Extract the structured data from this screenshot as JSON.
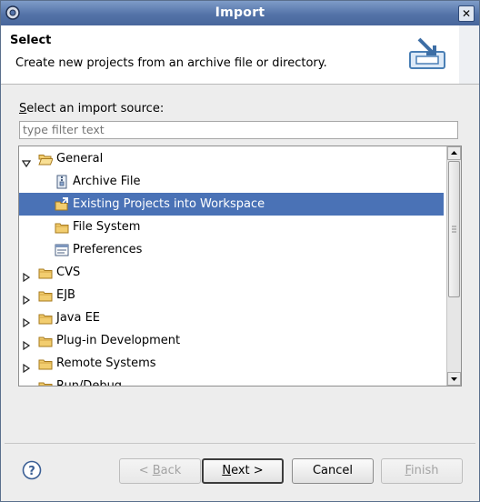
{
  "window": {
    "title": "Import"
  },
  "header": {
    "title": "Select",
    "description": "Create new projects from an archive file or directory."
  },
  "source_label": {
    "mnemonic": "S",
    "rest": "elect an import source:"
  },
  "filter": {
    "placeholder": "type filter text",
    "value": ""
  },
  "tree": {
    "items": [
      {
        "label": "General",
        "expanded": true,
        "level": 0,
        "icon": "folder-open-icon"
      },
      {
        "label": "Archive File",
        "level": 1,
        "icon": "archive-file-icon"
      },
      {
        "label": "Existing Projects into Workspace",
        "level": 1,
        "icon": "existing-projects-icon",
        "selected": true
      },
      {
        "label": "File System",
        "level": 1,
        "icon": "folder-icon"
      },
      {
        "label": "Preferences",
        "level": 1,
        "icon": "preferences-icon"
      },
      {
        "label": "CVS",
        "level": 0,
        "icon": "folder-icon"
      },
      {
        "label": "EJB",
        "level": 0,
        "icon": "folder-icon"
      },
      {
        "label": "Java EE",
        "level": 0,
        "icon": "folder-icon"
      },
      {
        "label": "Plug-in Development",
        "level": 0,
        "icon": "folder-icon"
      },
      {
        "label": "Remote Systems",
        "level": 0,
        "icon": "folder-icon"
      },
      {
        "label": "Run/Debug",
        "level": 0,
        "icon": "folder-icon"
      }
    ]
  },
  "buttons": {
    "back": {
      "prefix": "< ",
      "mnemonic": "B",
      "rest": "ack"
    },
    "next": {
      "mnemonic": "N",
      "rest": "ext >"
    },
    "cancel": "Cancel",
    "finish": {
      "mnemonic": "F",
      "rest": "inish"
    }
  },
  "colors": {
    "titlebar": "#5473a8",
    "selection": "#4a72b6",
    "folder": "#e8b64c"
  }
}
